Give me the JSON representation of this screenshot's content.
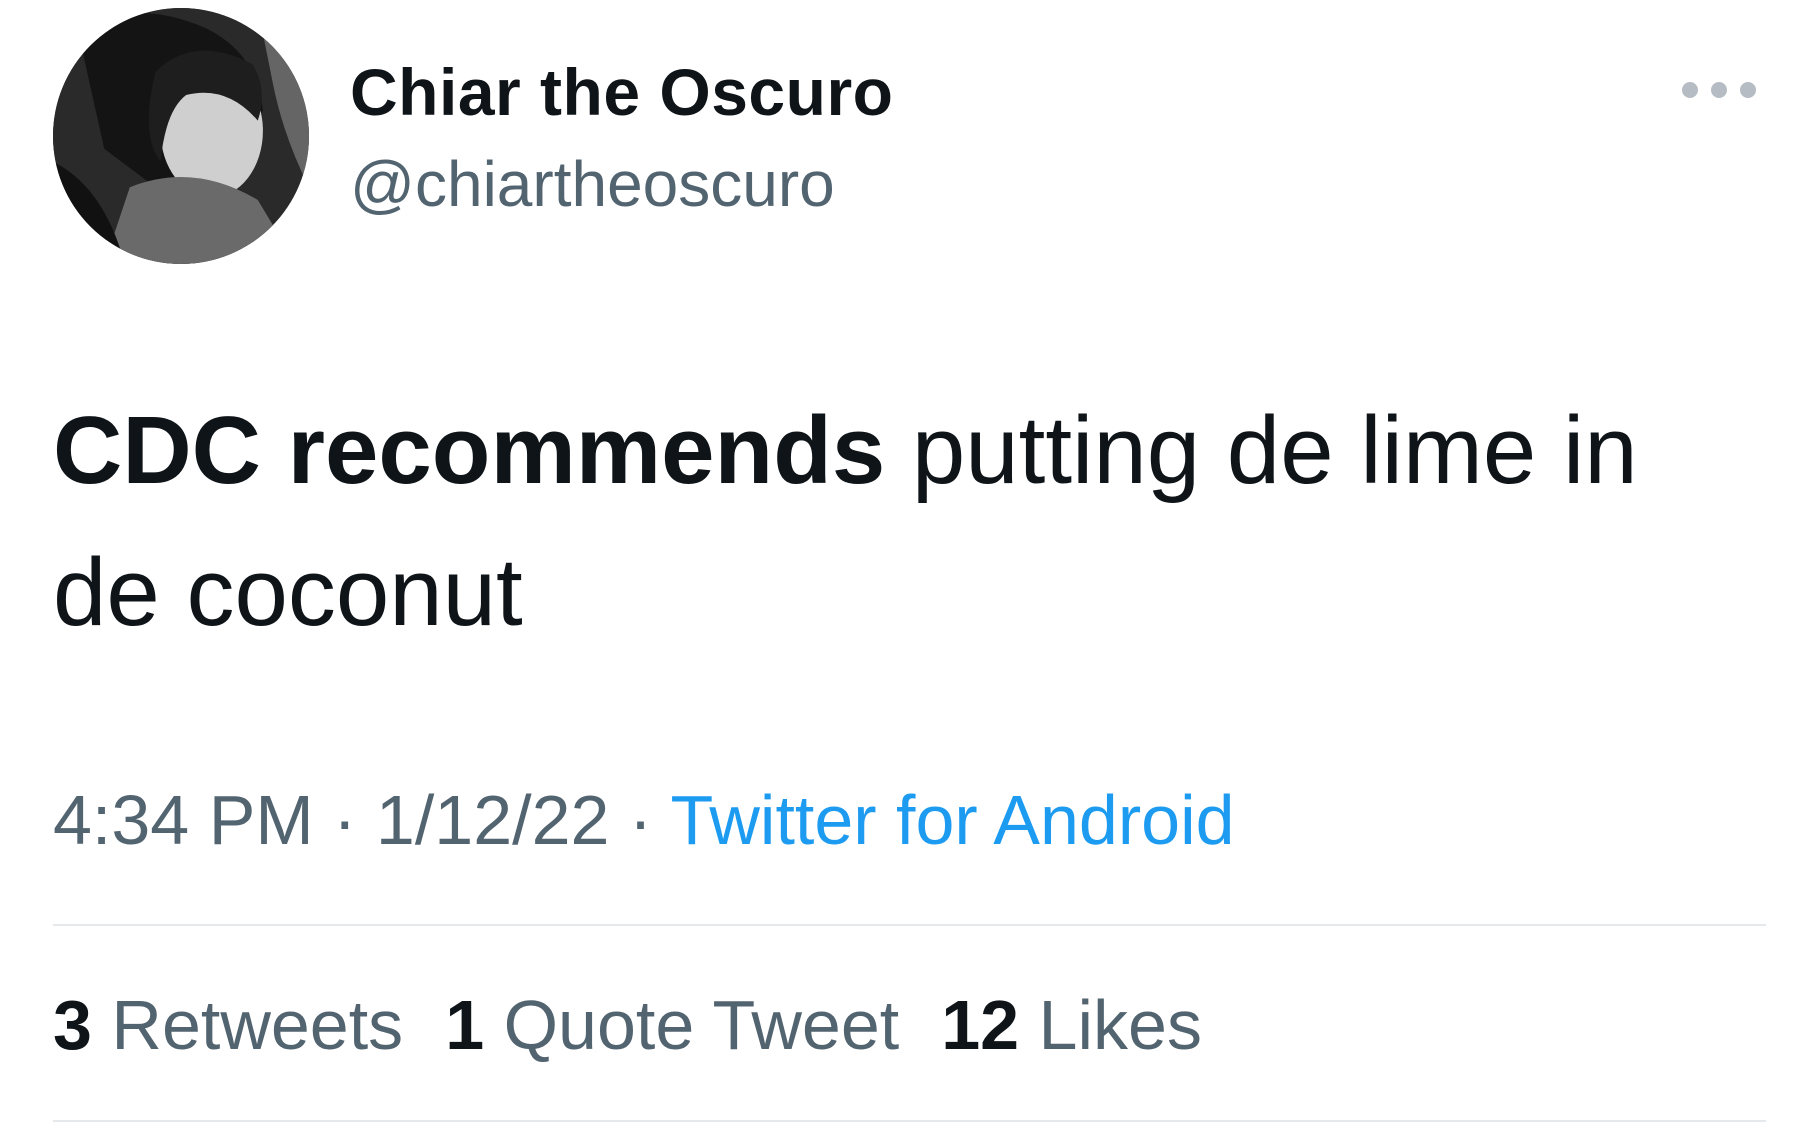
{
  "author": {
    "display_name": "Chiar the Oscuro",
    "handle": "@chiartheoscuro"
  },
  "tweet": {
    "text_bold": "CDC recommends",
    "text_rest": " putting de lime in de coconut"
  },
  "meta": {
    "time": "4:34 PM",
    "separator": " · ",
    "date": "1/12/22",
    "source": "Twitter for Android"
  },
  "stats": {
    "retweets_count": "3",
    "retweets_label": " Retweets",
    "quotes_count": "1",
    "quotes_label": " Quote Tweet",
    "likes_count": "12",
    "likes_label": " Likes"
  },
  "colors": {
    "text_primary": "#0f1419",
    "text_secondary": "#536471",
    "link": "#1d9bf0",
    "divider": "#e6e9ec"
  },
  "icons": {
    "more": "more-options-icon",
    "avatar": "profile-avatar"
  }
}
